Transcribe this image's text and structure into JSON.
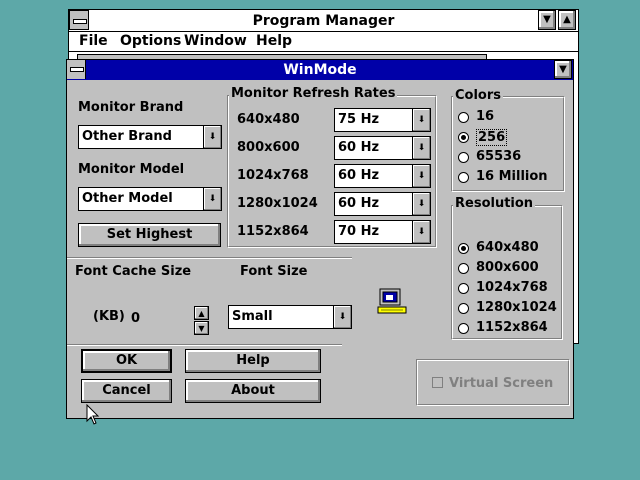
{
  "program_manager": {
    "title": "Program Manager",
    "menu": [
      "File",
      "Options",
      "Window",
      "Help"
    ]
  },
  "dialog": {
    "title": "WinMode",
    "monitor_brand": {
      "label": "Monitor Brand",
      "value": "Other Brand"
    },
    "monitor_model": {
      "label": "Monitor Model",
      "value": "Other Model"
    },
    "set_highest_label": "Set Highest",
    "refresh": {
      "title": "Monitor Refresh Rates",
      "rows": [
        {
          "res": "640x480",
          "rate": "75 Hz"
        },
        {
          "res": "800x600",
          "rate": "60 Hz"
        },
        {
          "res": "1024x768",
          "rate": "60 Hz"
        },
        {
          "res": "1280x1024",
          "rate": "60 Hz"
        },
        {
          "res": "1152x864",
          "rate": "70 Hz"
        }
      ]
    },
    "colors": {
      "title": "Colors",
      "options": [
        "16",
        "256",
        "65536",
        "16 Million"
      ],
      "selected": "256"
    },
    "resolution": {
      "title": "Resolution",
      "options": [
        "640x480",
        "800x600",
        "1024x768",
        "1280x1024",
        "1152x864"
      ],
      "selected": "640x480"
    },
    "font_cache": {
      "title": "Font Cache Size",
      "unit": "(KB)",
      "value": "0"
    },
    "font_size": {
      "title": "Font Size",
      "value": "Small"
    },
    "buttons": {
      "ok": "OK",
      "help": "Help",
      "cancel": "Cancel",
      "about": "About"
    },
    "virtual_screen": {
      "label": "Virtual Screen",
      "checked": false,
      "enabled": false
    }
  },
  "colors_palette": {
    "desktop": "#5da8a8",
    "title_active": "#0000a8",
    "face": "#c0c0c0"
  }
}
